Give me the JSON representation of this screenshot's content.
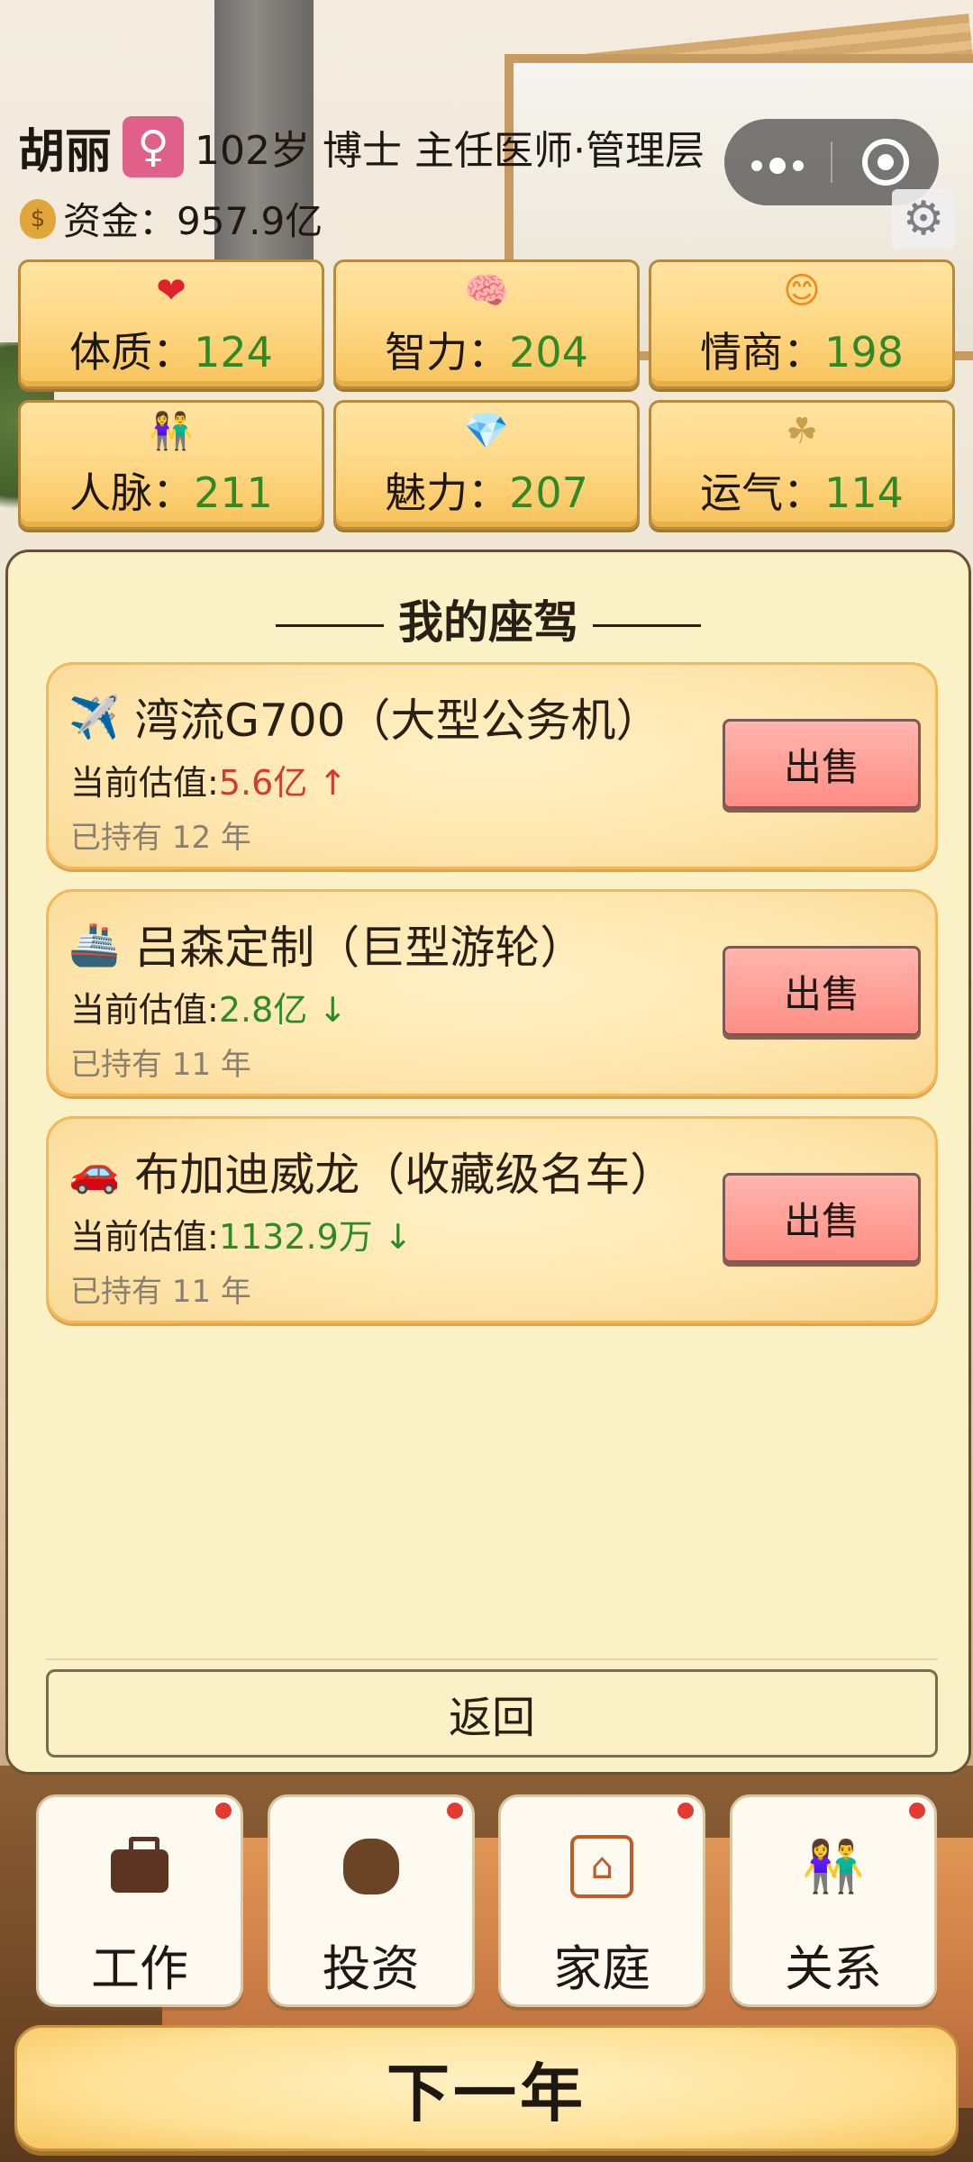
{
  "player": {
    "name": "胡丽",
    "gender_symbol": "♀",
    "profile": "102岁 博士 主任医师·管理层",
    "money_label": "资金：957.9亿"
  },
  "capsule": {
    "more": "•●•"
  },
  "stats": [
    {
      "label": "体质：",
      "value": "124",
      "icon": "heart-icon",
      "glyph": "❤",
      "color": "#e0222c"
    },
    {
      "label": "智力：",
      "value": "204",
      "icon": "brain-icon",
      "glyph": "🧠",
      "color": "#3a7fd0"
    },
    {
      "label": "情商：",
      "value": "198",
      "icon": "smile-heart-icon",
      "glyph": "😊",
      "color": "#f08a1a"
    },
    {
      "label": "人脉：",
      "value": "211",
      "icon": "people-icon",
      "glyph": "👫",
      "color": "#2f8a26"
    },
    {
      "label": "魅力：",
      "value": "207",
      "icon": "gem-icon",
      "glyph": "💎",
      "color": "#7a2fb8"
    },
    {
      "label": "运气：",
      "value": "114",
      "icon": "clover-icon",
      "glyph": "☘",
      "color": "#c9a04a"
    }
  ],
  "panel": {
    "title": "我的座驾",
    "vehicles": [
      {
        "icon": "airplane-icon",
        "glyph": "✈️",
        "name": "湾流G700（大型公务机）",
        "value_label": "当前估值:",
        "value": "5.6亿 ↑",
        "trend": "up",
        "held": "已持有 12 年",
        "sell": "出售"
      },
      {
        "icon": "ship-icon",
        "glyph": "🚢",
        "name": "吕森定制（巨型游轮）",
        "value_label": "当前估值:",
        "value": "2.8亿 ↓",
        "trend": "down",
        "held": "已持有 11 年",
        "sell": "出售"
      },
      {
        "icon": "car-icon",
        "glyph": "🚗",
        "name": "布加迪威龙（收藏级名车）",
        "value_label": "当前估值:",
        "value": "1132.9万 ↓",
        "trend": "down",
        "held": "已持有 11 年",
        "sell": "出售"
      }
    ],
    "back": "返回"
  },
  "nav": [
    {
      "label": "工作",
      "icon": "briefcase-icon"
    },
    {
      "label": "投资",
      "icon": "money-bag-icon"
    },
    {
      "label": "家庭",
      "icon": "house-icon"
    },
    {
      "label": "关系",
      "icon": "relationship-icon"
    }
  ],
  "next_year": "下一年"
}
